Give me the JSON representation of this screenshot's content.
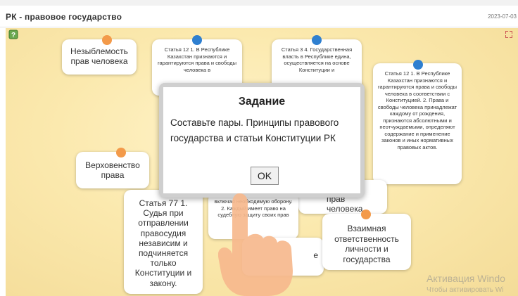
{
  "header": {
    "title": "РК - правовое государство",
    "date": "2023-07-03"
  },
  "icons": {
    "help": "help-question-icon",
    "expand": "expand-icon"
  },
  "cards": {
    "c1": "Незыблемость прав человека",
    "c2": "Статья 12 1. В Республике Казахстан признаются и гарантируются права и свободы человека в",
    "c3": "Статья 3 4. Государственная власть в Республике едина, осуществляется на основе Конституции и",
    "c4": "Статья 12 1. В Республике Казахстан признаются и гарантируются права и свободы человека в соответствии с Конституцией. 2. Права и свободы человека принадлежат каждому от рождения, признаются абсолютными и неотчуждаемыми, определяют содержание и применение законов и иных нормативных правовых актов.",
    "c5": "Верховенство права",
    "c6": "Статья 77 1. Судья при отправлении правосудия независим и подчиняется только Конституции и закону.",
    "c7": "включая необходимую оборону. 2. Каждый имеет право на судебную защиту своих прав",
    "c8": "прав человека",
    "c9": "Взаимная ответственность личности и государства",
    "c10": "е"
  },
  "dialog": {
    "title": "Задание",
    "text": "Составьте пары. Принципы правового государства и статьи Конституции РК",
    "ok_label": "OK"
  },
  "watermark": {
    "title": "Активация Windo",
    "subtitle": "Чтобы активировать Wi"
  },
  "colors": {
    "orange_dot": "#f39a4a",
    "blue_dot": "#2e7fd0",
    "stage_bg": "#fbe9ae"
  }
}
